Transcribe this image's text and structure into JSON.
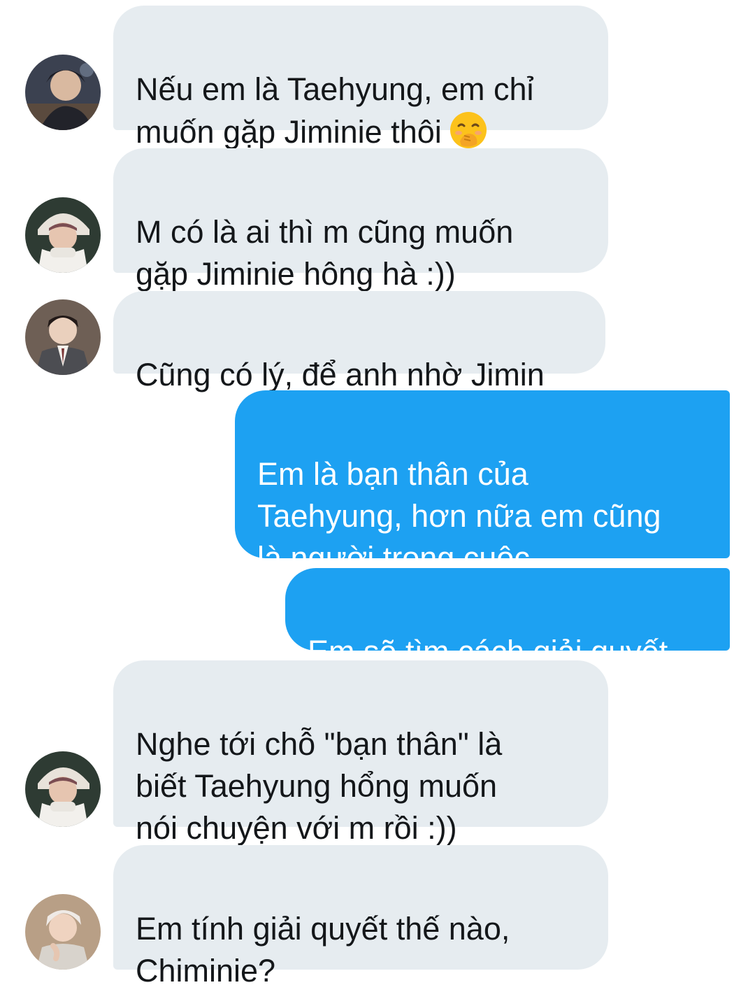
{
  "conversation": {
    "messages": [
      {
        "sender": "other",
        "avatar": "avatar-dark-hair-icon",
        "text": "Nếu em là Taehyung, em chỉ\nmuốn gặp Jiminie thôi",
        "emoji": "hand-over-mouth-emoji"
      },
      {
        "sender": "other",
        "avatar": "avatar-white-hat-icon",
        "text": "M có là ai thì m cũng muốn\ngặp Jiminie hông hà :))"
      },
      {
        "sender": "other",
        "avatar": "avatar-suit-icon",
        "text": "Cũng có lý, để anh nhờ Jimin"
      },
      {
        "sender": "self",
        "text": "Em là bạn thân của\nTaehyung, hơn nữa em cũng\nlà người trong cuộc"
      },
      {
        "sender": "self",
        "text": "Em sẽ tìm cách giải quyết"
      },
      {
        "sender": "other",
        "avatar": "avatar-white-hat-icon",
        "text": "Nghe tới chỗ \"bạn thân\" là\nbiết Taehyung hổng muốn\nnói chuyện với m rồi :))"
      },
      {
        "sender": "other",
        "avatar": "avatar-light-hair-icon",
        "text": "Em tính giải quyết thế nào,\nChiminie?"
      }
    ]
  },
  "colors": {
    "incoming_bubble": "#e6ecf0",
    "incoming_text": "#14171a",
    "outgoing_bubble": "#1da1f2",
    "outgoing_text": "#ffffff"
  }
}
